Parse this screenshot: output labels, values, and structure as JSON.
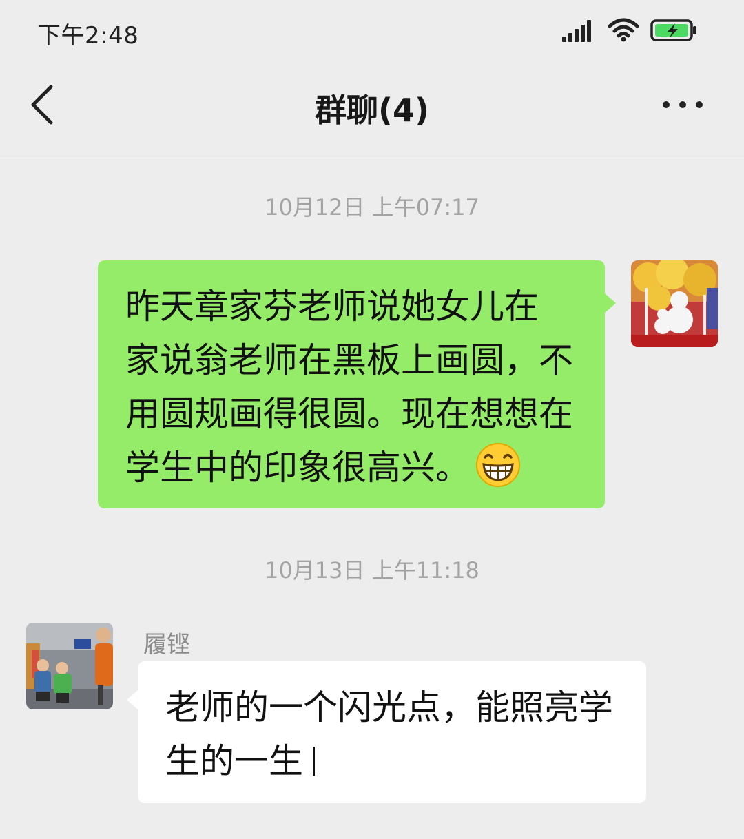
{
  "status_bar": {
    "time": "下午2:48",
    "signal_icon": "signal-bars-icon",
    "wifi_icon": "wifi-icon",
    "battery_icon": "battery-charging-icon"
  },
  "nav": {
    "back_icon": "chevron-left-icon",
    "title": "群聊(4)",
    "more_icon": "more-dots-icon"
  },
  "messages": [
    {
      "timestamp": "10月12日 上午07:17",
      "direction": "outgoing",
      "lines": [
        "昨天章家芬老师说她女儿在",
        "家说翁老师在黑板上画圆，不",
        "用圆规画得很圆。现在想想在",
        "学生中的印象很高兴。"
      ],
      "emoji": "grinning-face-icon",
      "avatar": "avatar-snowmen-photo"
    },
    {
      "timestamp": "10月13日 上午11:18",
      "direction": "incoming",
      "sender": "履铿",
      "lines": [
        "老师的一个闪光点，能照亮学",
        "生的一生"
      ],
      "avatar": "avatar-children-photo"
    }
  ],
  "colors": {
    "background": "#ededed",
    "outgoing_bubble": "#95ec69",
    "incoming_bubble": "#ffffff",
    "timestamp": "#a3a3a3",
    "battery_fill": "#4cd964"
  }
}
